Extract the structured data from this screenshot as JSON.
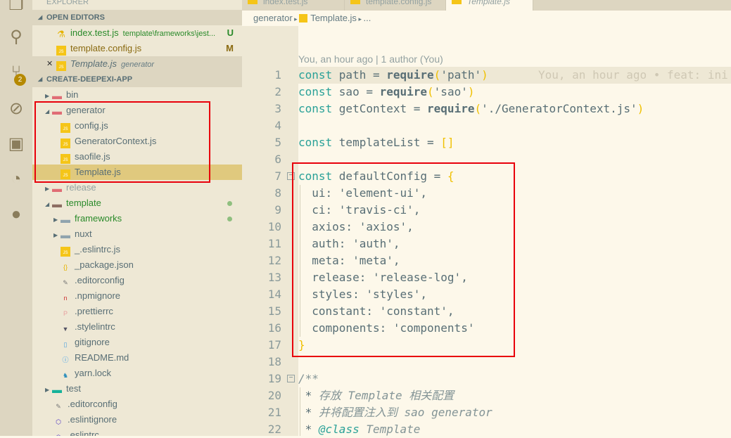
{
  "activity_bar": {
    "icons": [
      "files-icon",
      "search-icon",
      "source-control-icon",
      "debug-icon",
      "extensions-icon",
      "gitlens-icon",
      "github-icon"
    ],
    "scm_badge": "2"
  },
  "sidebar": {
    "title": "EXPLORER",
    "open_editors": {
      "header": "OPEN EDITORS",
      "items": [
        {
          "name": "index.test.js",
          "desc": "template\\frameworks\\jest...",
          "status": "U"
        },
        {
          "name": "template.config.js",
          "desc": "",
          "status": "M"
        },
        {
          "name": "Template.js",
          "desc": "generator",
          "status": ""
        }
      ]
    },
    "project": {
      "header": "CREATE-DEEPEXI-APP",
      "items": [
        {
          "name": "bin",
          "depth": 0,
          "type": "folder",
          "expanded": false
        },
        {
          "name": "generator",
          "depth": 0,
          "type": "folder",
          "expanded": true
        },
        {
          "name": "config.js",
          "depth": 1,
          "type": "js"
        },
        {
          "name": "GeneratorContext.js",
          "depth": 1,
          "type": "js"
        },
        {
          "name": "saofile.js",
          "depth": 1,
          "type": "js"
        },
        {
          "name": "Template.js",
          "depth": 1,
          "type": "js",
          "selected": true
        },
        {
          "name": "release",
          "depth": 0,
          "type": "folder",
          "expanded": false
        },
        {
          "name": "template",
          "depth": 0,
          "type": "folder",
          "expanded": true,
          "modified": true
        },
        {
          "name": "frameworks",
          "depth": 1,
          "type": "folder",
          "expanded": false,
          "modified": true
        },
        {
          "name": "nuxt",
          "depth": 1,
          "type": "folder",
          "expanded": false
        },
        {
          "name": "_.eslintrc.js",
          "depth": 1,
          "type": "js"
        },
        {
          "name": "_package.json",
          "depth": 1,
          "type": "json"
        },
        {
          "name": ".editorconfig",
          "depth": 1,
          "type": "editorconfig"
        },
        {
          "name": ".npmignore",
          "depth": 1,
          "type": "npm"
        },
        {
          "name": ".prettierrc",
          "depth": 1,
          "type": "prettier"
        },
        {
          "name": ".stylelintrc",
          "depth": 1,
          "type": "stylelint"
        },
        {
          "name": "gitignore",
          "depth": 1,
          "type": "file"
        },
        {
          "name": "README.md",
          "depth": 1,
          "type": "info"
        },
        {
          "name": "yarn.lock",
          "depth": 1,
          "type": "yarn"
        },
        {
          "name": "test",
          "depth": 0,
          "type": "folder",
          "expanded": false
        },
        {
          "name": ".editorconfig",
          "depth": 0,
          "type": "editorconfig"
        },
        {
          "name": ".eslintignore",
          "depth": 0,
          "type": "eslint"
        },
        {
          "name": ".eslintrc",
          "depth": 0,
          "type": "eslint"
        }
      ]
    }
  },
  "tabs": [
    {
      "label": "index.test.js"
    },
    {
      "label": "template.config.js"
    },
    {
      "label": "Template.js",
      "active": true
    }
  ],
  "breadcrumb": {
    "parts": [
      "generator",
      "Template.js",
      "..."
    ]
  },
  "editor": {
    "codelens": "You, an hour ago | 1 author (You)",
    "blame": "You, an hour ago • feat: ini",
    "lines": [
      [
        [
          "const ",
          "kw"
        ],
        [
          "path = ",
          ""
        ],
        [
          "require",
          "req"
        ],
        [
          "(",
          "br"
        ],
        [
          "'path'",
          "str"
        ],
        [
          ")",
          "br"
        ]
      ],
      [
        [
          "const ",
          "kw"
        ],
        [
          "sao = ",
          ""
        ],
        [
          "require",
          "req"
        ],
        [
          "(",
          "br"
        ],
        [
          "'sao'",
          "str"
        ],
        [
          ")",
          "br"
        ]
      ],
      [
        [
          "const ",
          "kw"
        ],
        [
          "getContext = ",
          ""
        ],
        [
          "require",
          "req"
        ],
        [
          "(",
          "br"
        ],
        [
          "'./GeneratorContext.js'",
          "str"
        ],
        [
          ")",
          "br"
        ]
      ],
      [],
      [
        [
          "const ",
          "kw"
        ],
        [
          "templateList = ",
          ""
        ],
        [
          "[]",
          "br"
        ]
      ],
      [],
      [
        [
          "const ",
          "kw"
        ],
        [
          "defaultConfig = ",
          ""
        ],
        [
          "{",
          "br"
        ]
      ],
      [
        [
          "  ui: 'element-ui',",
          ""
        ]
      ],
      [
        [
          "  ci: 'travis-ci',",
          ""
        ]
      ],
      [
        [
          "  axios: 'axios',",
          ""
        ]
      ],
      [
        [
          "  auth: 'auth',",
          ""
        ]
      ],
      [
        [
          "  meta: 'meta',",
          ""
        ]
      ],
      [
        [
          "  release: 'release-log',",
          ""
        ]
      ],
      [
        [
          "  styles: 'styles',",
          ""
        ]
      ],
      [
        [
          "  constant: 'constant',",
          ""
        ]
      ],
      [
        [
          "  components: 'components'",
          ""
        ]
      ],
      [
        [
          "}",
          "br"
        ]
      ],
      [],
      [
        [
          "/**",
          "cm"
        ]
      ],
      [
        [
          " * ",
          ""
        ],
        [
          "存放 ",
          "cm"
        ],
        [
          "Template",
          "cm"
        ],
        [
          " 相关配置",
          "cm"
        ]
      ],
      [
        [
          " * ",
          ""
        ],
        [
          "并将配置注入到 sao generator",
          "cm"
        ]
      ],
      [
        [
          " * ",
          ""
        ],
        [
          "@class",
          "tag"
        ],
        [
          " Template",
          "cm"
        ]
      ]
    ]
  }
}
